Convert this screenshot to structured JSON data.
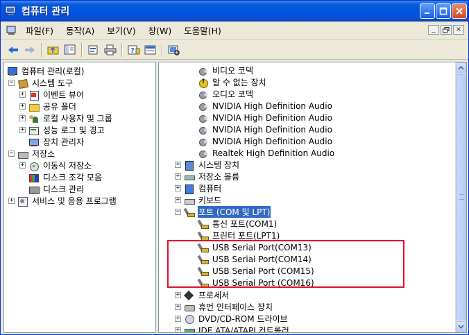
{
  "window": {
    "title": "컴퓨터 관리"
  },
  "menu": [
    "파일(F)",
    "동작(A)",
    "보기(V)",
    "창(W)",
    "도움말(H)"
  ],
  "mdi_controls": [
    "_",
    "♬",
    "×"
  ],
  "left_tree": [
    {
      "label": "컴퓨터 관리(로컬)",
      "icon": "computer-icon",
      "level": 0,
      "expander": ""
    },
    {
      "label": "시스템 도구",
      "icon": "tools-icon",
      "level": 1,
      "expander": "−"
    },
    {
      "label": "이벤트 뷰어",
      "icon": "event-viewer-icon",
      "level": 2,
      "expander": "+"
    },
    {
      "label": "공유 폴더",
      "icon": "folder-icon",
      "level": 2,
      "expander": "+"
    },
    {
      "label": "로컬 사용자 및 그룹",
      "icon": "users-icon",
      "level": 2,
      "expander": "+"
    },
    {
      "label": "성능 로그 및 경고",
      "icon": "performance-icon",
      "level": 2,
      "expander": "+"
    },
    {
      "label": "장치 관리자",
      "icon": "device-manager-icon",
      "level": 2,
      "expander": ""
    },
    {
      "label": "저장소",
      "icon": "storage-icon",
      "level": 1,
      "expander": "−"
    },
    {
      "label": "이동식 저장소",
      "icon": "removable-storage-icon",
      "level": 2,
      "expander": "+"
    },
    {
      "label": "디스크 조각 모음",
      "icon": "defrag-icon",
      "level": 2,
      "expander": ""
    },
    {
      "label": "디스크 관리",
      "icon": "disk-management-icon",
      "level": 2,
      "expander": ""
    },
    {
      "label": "서비스 및 응용 프로그램",
      "icon": "services-icon",
      "level": 1,
      "expander": "+"
    }
  ],
  "right_tree": [
    {
      "label": "비디오 코덱",
      "icon": "sound-icon",
      "level": 2,
      "expander": ""
    },
    {
      "label": "알 수 없는 장치",
      "icon": "warning-icon",
      "level": 2,
      "expander": ""
    },
    {
      "label": "오디오 코덱",
      "icon": "sound-icon",
      "level": 2,
      "expander": ""
    },
    {
      "label": "NVIDIA High Definition Audio",
      "icon": "sound-icon",
      "level": 2,
      "expander": ""
    },
    {
      "label": "NVIDIA High Definition Audio",
      "icon": "sound-icon",
      "level": 2,
      "expander": ""
    },
    {
      "label": "NVIDIA High Definition Audio",
      "icon": "sound-icon",
      "level": 2,
      "expander": ""
    },
    {
      "label": "NVIDIA High Definition Audio",
      "icon": "sound-icon",
      "level": 2,
      "expander": ""
    },
    {
      "label": "Realtek High Definition Audio",
      "icon": "sound-icon",
      "level": 2,
      "expander": ""
    },
    {
      "label": "시스템 장치",
      "icon": "system-device-icon",
      "level": 1,
      "expander": "+"
    },
    {
      "label": "저장소 볼륨",
      "icon": "volume-icon",
      "level": 1,
      "expander": "+"
    },
    {
      "label": "컴퓨터",
      "icon": "pc-icon",
      "level": 1,
      "expander": "+"
    },
    {
      "label": "키보드",
      "icon": "keyboard-icon",
      "level": 1,
      "expander": "+"
    },
    {
      "label": "포트 (COM 및 LPT)",
      "icon": "port-icon",
      "level": 1,
      "expander": "−",
      "selected": true
    },
    {
      "label": "통신 포트(COM1)",
      "icon": "port-icon",
      "level": 2,
      "expander": ""
    },
    {
      "label": "프린터 포트(LPT1)",
      "icon": "port-icon",
      "level": 2,
      "expander": ""
    },
    {
      "label": "USB Serial Port(COM13)",
      "icon": "port-icon",
      "level": 2,
      "expander": ""
    },
    {
      "label": "USB Serial Port(COM14)",
      "icon": "port-icon",
      "level": 2,
      "expander": ""
    },
    {
      "label": "USB Serial Port (COM15)",
      "icon": "port-icon",
      "level": 2,
      "expander": ""
    },
    {
      "label": "USB Serial Port (COM16)",
      "icon": "port-icon",
      "level": 2,
      "expander": ""
    },
    {
      "label": "프로세서",
      "icon": "processor-icon",
      "level": 1,
      "expander": "+"
    },
    {
      "label": "휴먼 인터페이스 장치",
      "icon": "hid-icon",
      "level": 1,
      "expander": "+"
    },
    {
      "label": "DVD/CD-ROM 드라이브",
      "icon": "dvd-icon",
      "level": 1,
      "expander": "+"
    },
    {
      "label": "IDE ATA/ATAPI 컨트롤러",
      "icon": "ide-icon",
      "level": 1,
      "expander": "+"
    }
  ],
  "colors": {
    "title_bar": "#0054e3",
    "selection": "#316ac5",
    "highlight_box": "#e0102a"
  }
}
